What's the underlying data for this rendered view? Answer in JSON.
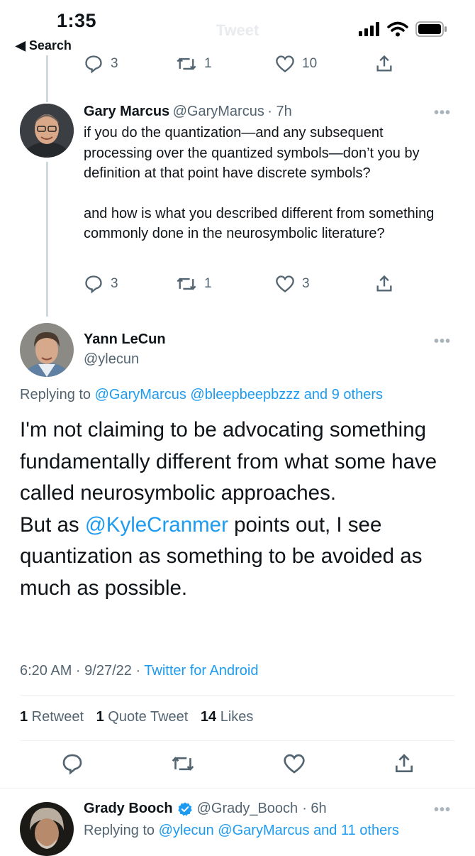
{
  "status_bar": {
    "time": "1:35",
    "back_label": "◀ Search",
    "nav_title": "Tweet"
  },
  "tweet1_actions": {
    "replies": "3",
    "retweets": "1",
    "likes": "10"
  },
  "tweet2": {
    "name": "Gary Marcus",
    "handle": "@GaryMarcus",
    "time": "· 7h",
    "para1": "if you do the quantization—and any subsequent processing over the quantized symbols—don’t you by definition at that point have discrete symbols?",
    "para2": "and how is what you described different from something commonly done in the neurosymbolic literature?",
    "replies": "3",
    "retweets": "1",
    "likes": "3"
  },
  "main": {
    "name": "Yann LeCun",
    "handle": "@ylecun",
    "replying_prefix": "Replying to ",
    "replying_targets": "@GaryMarcus @bleepbeepbzzz and 9 others",
    "text_a": "I'm not claiming to be advocating something fundamentally different from what some have called neurosymbolic approaches.",
    "text_b1": "But as ",
    "text_mention": "@KyleCranmer",
    "text_b2": " points out, I see quantization as something to be avoided as much as possible.",
    "time": "6:20 AM · 9/27/22 · ",
    "client": "Twitter for Android",
    "retweets_count": "1",
    "retweets_label": " Retweet",
    "quotes_count": "1",
    "quotes_label": " Quote Tweet",
    "likes_count": "14",
    "likes_label": " Likes"
  },
  "reply": {
    "name": "Grady Booch",
    "handle": "@Grady_Booch",
    "time": "· 6h",
    "replying_prefix": "Replying to ",
    "replying_targets": "@ylecun @GaryMarcus and 11 others"
  },
  "colors": {
    "link": "#1d9bf0",
    "secondary_text": "#536471",
    "verified": "#1d9bf0"
  }
}
